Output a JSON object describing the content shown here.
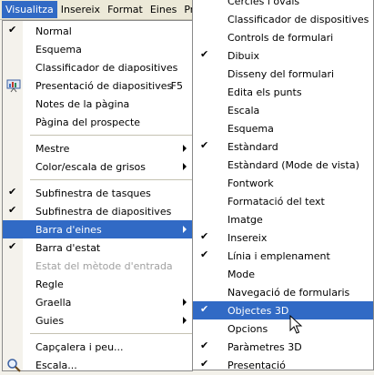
{
  "menubar": {
    "items": [
      {
        "label": "Visualitza",
        "mnemonic": "V",
        "rest": "isualitza"
      },
      {
        "label": "Insereix",
        "mnemonic": "I",
        "rest": "nsereix"
      },
      {
        "label": "Format",
        "mnemonic": "F",
        "rest": "ormat"
      },
      {
        "label": "Eines",
        "mnemonic": "E",
        "rest": "ines"
      },
      {
        "label": "Pre"
      }
    ]
  },
  "view_menu": {
    "normal": "Normal",
    "esquema": "Esquema",
    "classificador": "Classificador de diapositives",
    "presentacio": "Presentació de diapositives",
    "presentacio_shortcut": "F5",
    "notes": "Notes de la pàgina",
    "pagina_prospecte": "Pàgina del prospecte",
    "mestre": "Mestre",
    "color_escala": "Color/escala de grisos",
    "subfinestra_tasques": "Subfinestra de tasques",
    "subfinestra_diapositives": "Subfinestra de diapositives",
    "barra_eines": "Barra d'eines",
    "barra_estat": "Barra d'estat",
    "estat_metode": "Estat del mètode d'entrada",
    "regle": "Regle",
    "graella": "Graella",
    "guies": "Guies",
    "capcalera": "Capçalera i peu...",
    "escala": "Escala..."
  },
  "toolbars_submenu": {
    "items": [
      {
        "label": "Cercles i ovals",
        "checked": false
      },
      {
        "label": "Classificador de dispositives",
        "checked": false
      },
      {
        "label": "Controls de formulari",
        "checked": false
      },
      {
        "label": "Dibuix",
        "checked": true
      },
      {
        "label": "Disseny del formulari",
        "checked": false
      },
      {
        "label": "Edita els punts",
        "checked": false
      },
      {
        "label": "Escala",
        "checked": false
      },
      {
        "label": "Esquema",
        "checked": false
      },
      {
        "label": "Estàndard",
        "checked": true
      },
      {
        "label": "Estàndard (Mode de vista)",
        "checked": false
      },
      {
        "label": "Fontwork",
        "checked": false
      },
      {
        "label": "Formatació del text",
        "checked": false
      },
      {
        "label": "Imatge",
        "checked": false
      },
      {
        "label": "Insereix",
        "checked": true
      },
      {
        "label": "Línia i emplenament",
        "checked": true
      },
      {
        "label": "Mode",
        "checked": false
      },
      {
        "label": "Navegació de formularis",
        "checked": false
      },
      {
        "label": "Objectes 3D",
        "checked": true,
        "highlighted": true
      },
      {
        "label": "Opcions",
        "checked": false
      },
      {
        "label": "Paràmetres 3D",
        "checked": true
      },
      {
        "label": "Presentació",
        "checked": true
      }
    ]
  },
  "colors": {
    "highlight": "#316ac5",
    "menubar_bg": "#ece9d8",
    "disabled_text": "#a0a0a0"
  },
  "icons": {
    "presentacio": "slideshow-icon",
    "escala": "zoom-magnifier-icon"
  }
}
